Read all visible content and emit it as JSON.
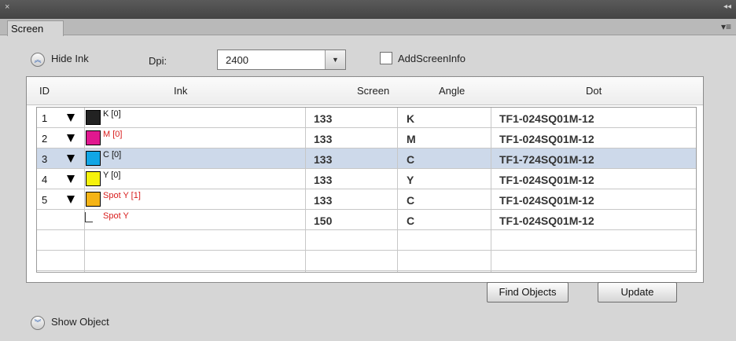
{
  "panel": {
    "close_glyph": "×",
    "collapse_glyph": "◂◂",
    "menu_glyph": "▾≡"
  },
  "tabs": [
    {
      "label": "Screen"
    }
  ],
  "hide_ink": {
    "label": "Hide Ink",
    "icon": "chevron-double-up-icon"
  },
  "dpi": {
    "label": "Dpi:",
    "value": "2400"
  },
  "add_screen_info": {
    "label": "AddScreenInfo",
    "checked": false
  },
  "table": {
    "headers": {
      "id": "ID",
      "ink": "Ink",
      "screen": "Screen",
      "angle": "Angle",
      "dot": "Dot"
    },
    "rows": [
      {
        "id": "1",
        "ink": "K [0]",
        "color": "#222222",
        "red": false,
        "screen": "133",
        "angle": "K",
        "dot": "TF1-024SQ01M-12",
        "selected": false,
        "sub": false
      },
      {
        "id": "2",
        "ink": "M [0]",
        "color": "#e0188f",
        "red": true,
        "screen": "133",
        "angle": "M",
        "dot": "TF1-024SQ01M-12",
        "selected": false,
        "sub": false
      },
      {
        "id": "3",
        "ink": "C [0]",
        "color": "#11a6e6",
        "red": false,
        "screen": "133",
        "angle": "C",
        "dot": "TF1-724SQ01M-12",
        "selected": true,
        "sub": false
      },
      {
        "id": "4",
        "ink": "Y [0]",
        "color": "#f6f20c",
        "red": false,
        "screen": "133",
        "angle": "Y",
        "dot": "TF1-024SQ01M-12",
        "selected": false,
        "sub": false
      },
      {
        "id": "5",
        "ink": "Spot Y [1]",
        "color": "#f5b416",
        "red": true,
        "screen": "133",
        "angle": "C",
        "dot": "TF1-024SQ01M-12",
        "selected": false,
        "sub": false
      },
      {
        "id": "",
        "ink": "Spot Y",
        "color": "",
        "red": true,
        "screen": "150",
        "angle": "C",
        "dot": "TF1-024SQ01M-12",
        "selected": false,
        "sub": true
      },
      {
        "id": "",
        "ink": "",
        "color": "",
        "red": false,
        "screen": "",
        "angle": "",
        "dot": "",
        "selected": false,
        "sub": false
      },
      {
        "id": "",
        "ink": "",
        "color": "",
        "red": false,
        "screen": "",
        "angle": "",
        "dot": "",
        "selected": false,
        "sub": false
      }
    ]
  },
  "buttons": {
    "find_objects": "Find Objects",
    "update": "Update"
  },
  "show_object": {
    "label": "Show Object",
    "icon": "chevron-double-down-icon"
  }
}
